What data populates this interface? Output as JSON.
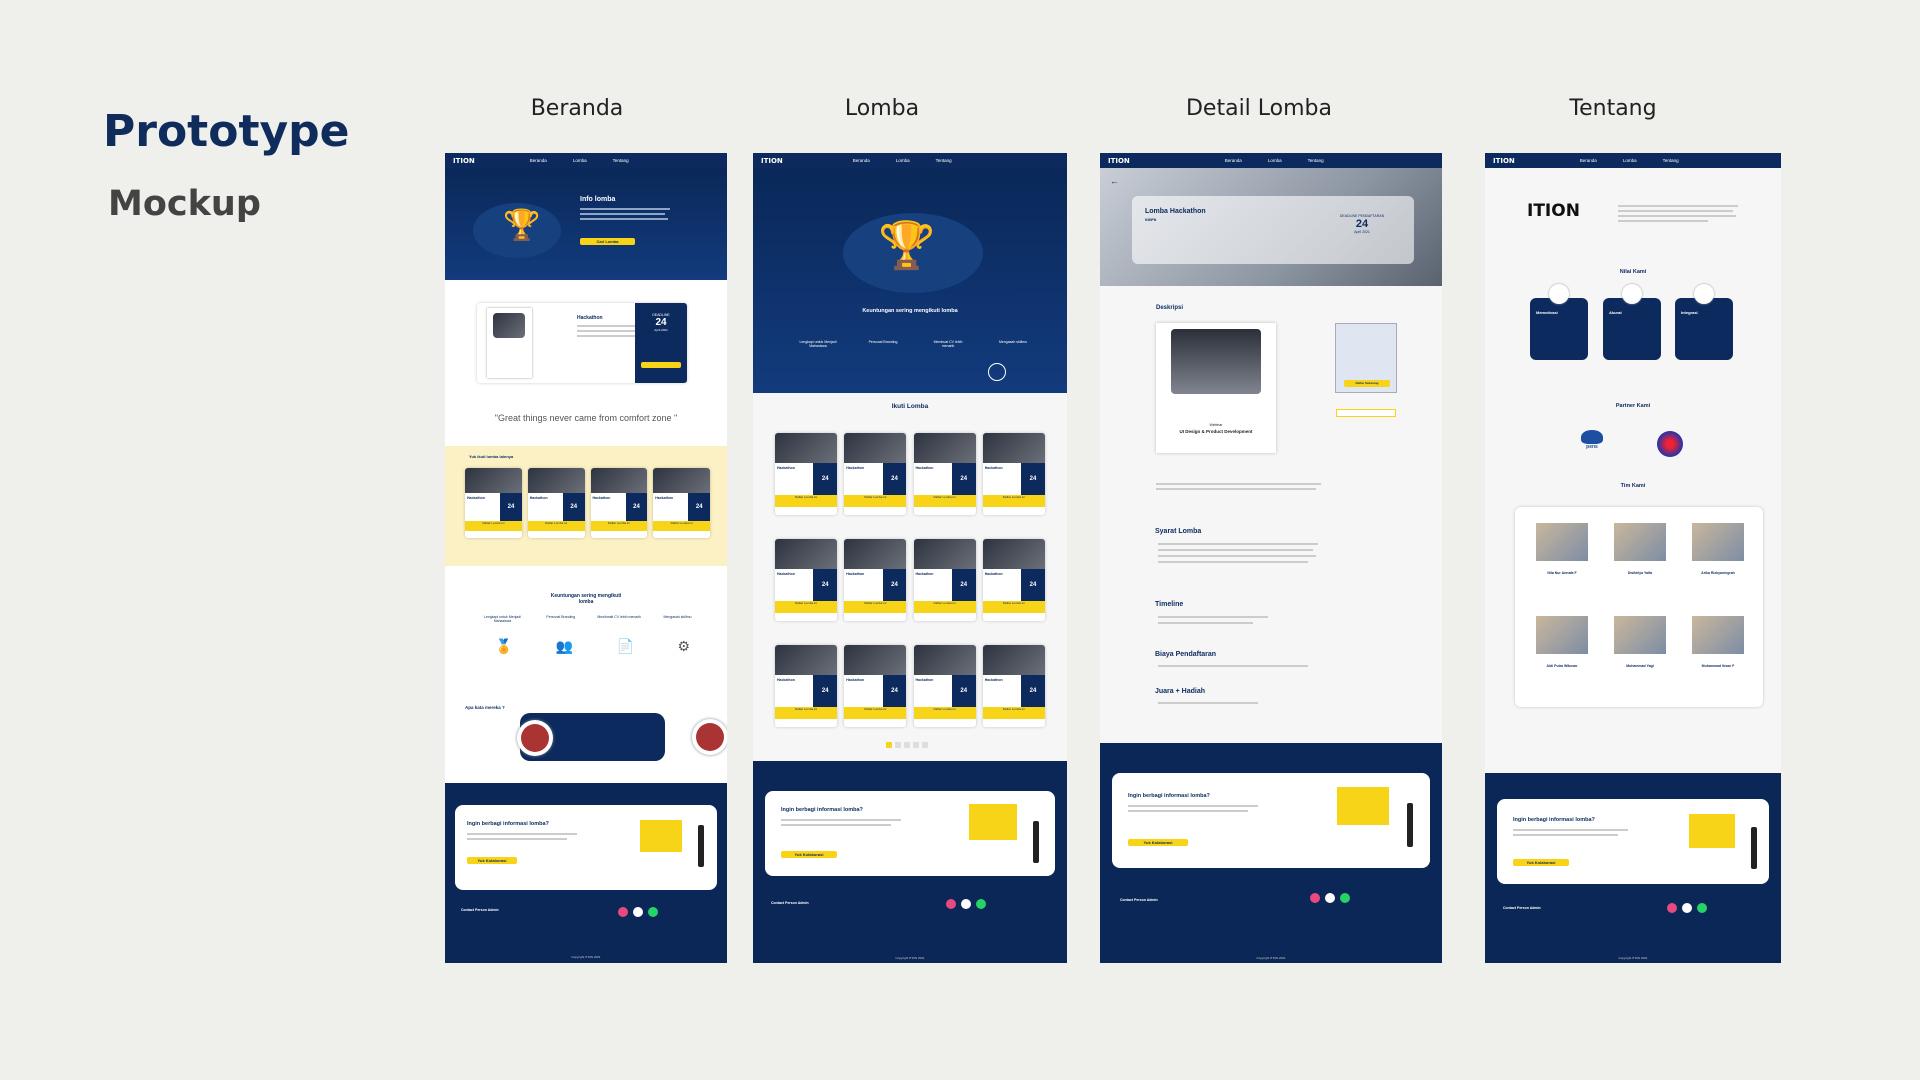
{
  "slide": {
    "title": "Prototype",
    "subtitle": "Mockup",
    "columns": [
      "Beranda",
      "Lomba",
      "Detail Lomba",
      "Tentang"
    ]
  },
  "site": {
    "logo": "ITION",
    "nav": [
      "Beranda",
      "Lomba",
      "Tentang"
    ]
  },
  "beranda": {
    "hero_title": "Info lomba",
    "hero_button": "Cari Lomba",
    "featured": {
      "name": "Hackathon",
      "day": "24",
      "deadline_label": "DEADLINE",
      "month": "April 2021"
    },
    "quote": "\"Great things never came from comfort zone \"",
    "strip_title": "Yuk ikuti lomba lainnya",
    "benefits_title": "Keuntungan sering mengikuti lomba",
    "benefits": [
      "Lengkapi untuk Menjadi Mahasiswa",
      "Personal Branding",
      "Menikmati CV lebih menarik",
      "Mengasah skillmu"
    ],
    "testimonial_title": "Apa kata mereka ?"
  },
  "lomba": {
    "hero_title": "Keuntungan sering mengikuti lomba",
    "benefits": [
      "Lengkapi untuk Menjadi Mahasiswa",
      "Personal Branding",
      "Membuat CV lebih menarik",
      "Mengasah skillmu"
    ],
    "section_title": "Ikuti Lomba",
    "card_name": "Hackathon",
    "card_day": "24",
    "card_button": "Daftar Lomba ini",
    "rows": 3,
    "cols": 4
  },
  "detail": {
    "title": "Lomba Hackathon",
    "org": "KMIPN",
    "deadline_label": "DEADLINE PENDAFTARAN",
    "day": "24",
    "month": "April 2021",
    "desc_title": "Deskripsi",
    "poster_sub": "Webinar",
    "poster_title": "UI Design & Product Development",
    "syarat": "Syarat Lomba",
    "timeline": "Timeline",
    "biaya": "Biaya Pendaftaran",
    "juara": "Juara + Hadiah",
    "btn_daftar": "Daftar Sekarang"
  },
  "tentang": {
    "logo": "ITION",
    "nilai_title": "Nilai Kami",
    "nilai": [
      "Memotivasi",
      "Akurat",
      "Integrasi"
    ],
    "partner_title": "Partner Kami",
    "partner_name": "pens",
    "tim_title": "Tim Kami",
    "tim": [
      "Nila Nur Annafa F",
      "Dwikhlya Yaifa",
      "Arika Rizkyaningrah",
      "Aldi Putra Wibowo",
      "Muhammad Yagi",
      "Muhammad Ihsan F"
    ]
  },
  "footer": {
    "collab_title": "Ingin berbagi informasi lomba?",
    "collab_button": "Yuk Kolaborasi",
    "contact_title": "Contact Person Admin",
    "copyright": "Copyright ITION 2021"
  },
  "colors": {
    "navy": "#0c2a5e",
    "yellow": "#f7d418",
    "background": "#efefec"
  }
}
